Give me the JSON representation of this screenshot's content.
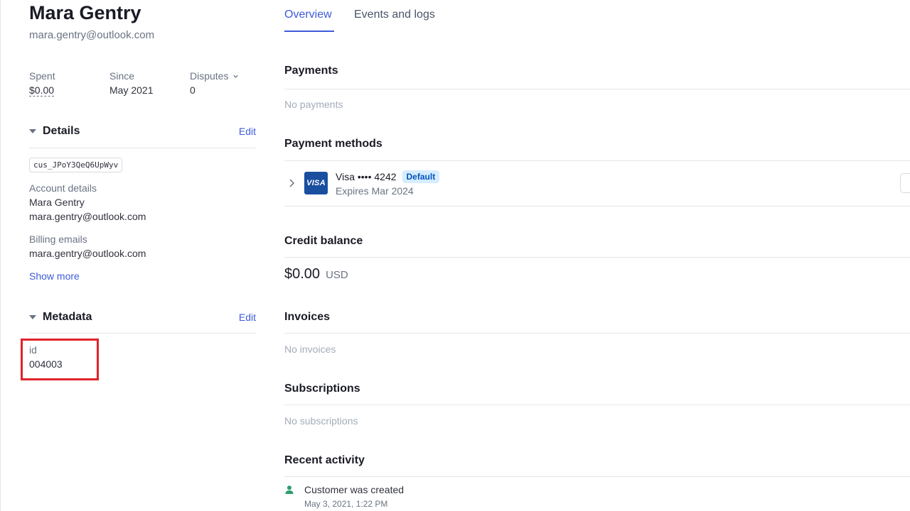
{
  "customer": {
    "name": "Mara Gentry",
    "email": "mara.gentry@outlook.com"
  },
  "stats": [
    {
      "label": "Spent",
      "value": "$0.00"
    },
    {
      "label": "Since",
      "value": "May 2021"
    },
    {
      "label": "Disputes",
      "value": "0"
    }
  ],
  "details": {
    "title": "Details",
    "edit_label": "Edit",
    "customer_id": "cus_JPoY3QeQ6UpWyv",
    "account_label": "Account details",
    "account_name": "Mara Gentry",
    "account_email": "mara.gentry@outlook.com",
    "billing_label": "Billing emails",
    "billing_email": "mara.gentry@outlook.com",
    "show_more": "Show more"
  },
  "metadata": {
    "title": "Metadata",
    "edit_label": "Edit",
    "key": "id",
    "value": "004003"
  },
  "tabs": [
    {
      "label": "Overview",
      "active": true
    },
    {
      "label": "Events and logs",
      "active": false
    }
  ],
  "sections": {
    "payments": {
      "title": "Payments",
      "empty": "No payments"
    },
    "payment_methods": {
      "title": "Payment methods",
      "card_brand_logo": "VISA",
      "card_label": "Visa •••• 4242",
      "badge": "Default",
      "expires": "Expires Mar 2024"
    },
    "credit_balance": {
      "title": "Credit balance",
      "amount": "$0.00",
      "currency": "USD"
    },
    "invoices": {
      "title": "Invoices",
      "empty": "No invoices"
    },
    "subscriptions": {
      "title": "Subscriptions",
      "empty": "No subscriptions"
    },
    "recent_activity": {
      "title": "Recent activity",
      "items": [
        {
          "icon": "person-icon",
          "text": "Customer was created",
          "time": "May 3, 2021, 1:22 PM"
        }
      ]
    }
  },
  "colors": {
    "accent": "#3d5bd9",
    "highlight": "#e0232a",
    "badge_bg": "#d6ecff",
    "visa_blue": "#1a4fa0",
    "activity_icon": "#2e9d6b"
  }
}
